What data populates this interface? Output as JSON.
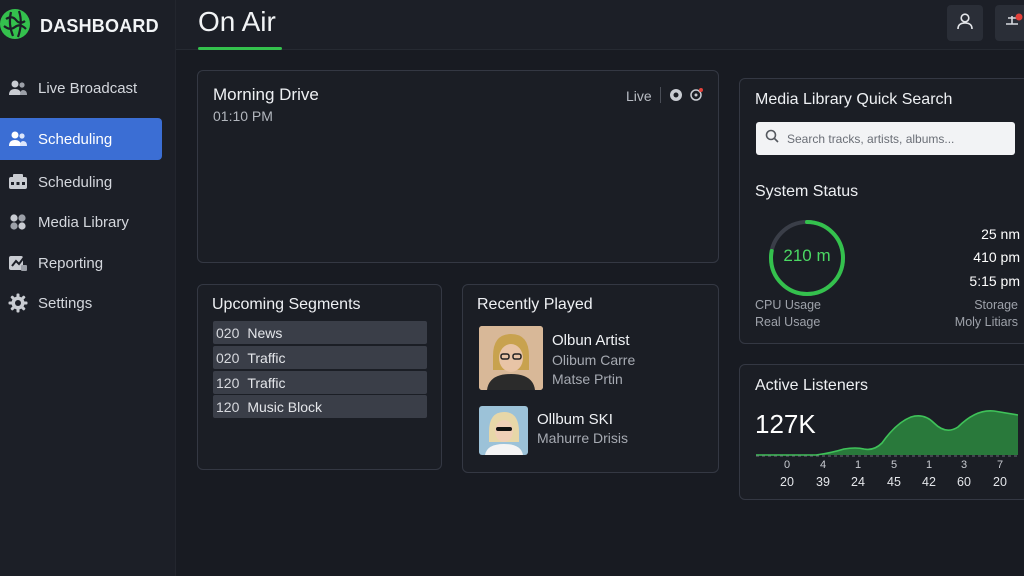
{
  "brand": {
    "name": "DASHBOARD",
    "accent": "#34c14d",
    "active_nav": "#3b6ed4"
  },
  "sidebar": {
    "items": [
      {
        "label": "Live Broadcast",
        "icon": "users-icon"
      },
      {
        "label": "Scheduling",
        "icon": "users-icon",
        "active": true
      },
      {
        "label": "Scheduling",
        "icon": "schedule-icon"
      },
      {
        "label": "Media Library",
        "icon": "media-icon"
      },
      {
        "label": "Reporting",
        "icon": "reporting-icon"
      },
      {
        "label": "Settings",
        "icon": "gear-icon"
      }
    ]
  },
  "header": {
    "title": "On Air"
  },
  "now_playing": {
    "title": "Morning Drive",
    "time": "01:10 PM",
    "status": "Live"
  },
  "upcoming": {
    "title": "Upcoming Segments",
    "rows": [
      {
        "code": "020",
        "name": "News"
      },
      {
        "code": "020",
        "name": "Traffic"
      },
      {
        "code": "120",
        "name": "Traffic"
      },
      {
        "code": "120",
        "name": "Music Block"
      }
    ]
  },
  "recent": {
    "title": "Recently Played",
    "items": [
      {
        "title": "Olbun Artist",
        "line1": "Olibum Carre",
        "line2": "Matse Prtin"
      },
      {
        "title": "Ollbum SKI",
        "line1": "Mahurre Drisis"
      }
    ]
  },
  "search": {
    "title": "Media Library Quick Search",
    "placeholder": "Search tracks, artists, albums..."
  },
  "system": {
    "title": "System Status",
    "gauge_value": "210 m",
    "gauge_fraction": 0.78,
    "stats": [
      "25 nm",
      "410 pm",
      "5:15 pm"
    ],
    "left_labels": [
      "CPU Usage",
      "Real Usage"
    ],
    "right_labels": [
      "Storage",
      "Moly Litiars"
    ]
  },
  "listeners": {
    "title": "Active Listeners",
    "count": "127K",
    "axis_top": [
      "0",
      "4",
      "1",
      "5",
      "1",
      "3",
      "7"
    ],
    "axis_bottom": [
      "20",
      "39",
      "24",
      "45",
      "42",
      "60",
      "20"
    ]
  }
}
